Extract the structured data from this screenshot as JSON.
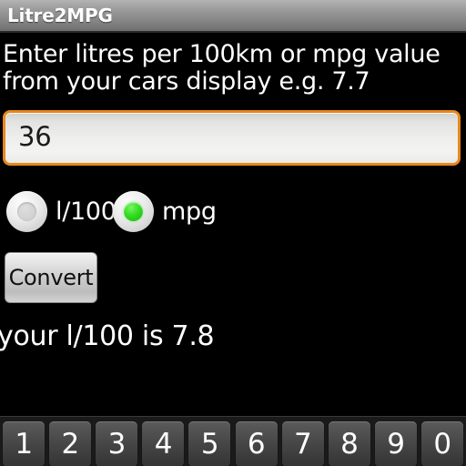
{
  "titlebar": {
    "app_title": "Litre2MPG"
  },
  "main": {
    "instructions": "Enter litres per 100km or mpg value from your cars display e.g. 7.7",
    "input": {
      "value": "36",
      "placeholder": ""
    },
    "radios": [
      {
        "id": "l100",
        "label": "l/100",
        "selected": false
      },
      {
        "id": "mpg",
        "label": "mpg",
        "selected": true
      }
    ],
    "convert_label": "Convert",
    "result_text": "your l/100 is 7.8"
  },
  "keyboard": {
    "keys": [
      "1",
      "2",
      "3",
      "4",
      "5",
      "6",
      "7",
      "8",
      "9",
      "0"
    ]
  },
  "colors": {
    "accent_focus": "#e8871a",
    "radio_selected": "#2ad61e",
    "background": "#000000",
    "titlebar_top": "#b3b3b3",
    "titlebar_bottom": "#6f6f6f"
  }
}
